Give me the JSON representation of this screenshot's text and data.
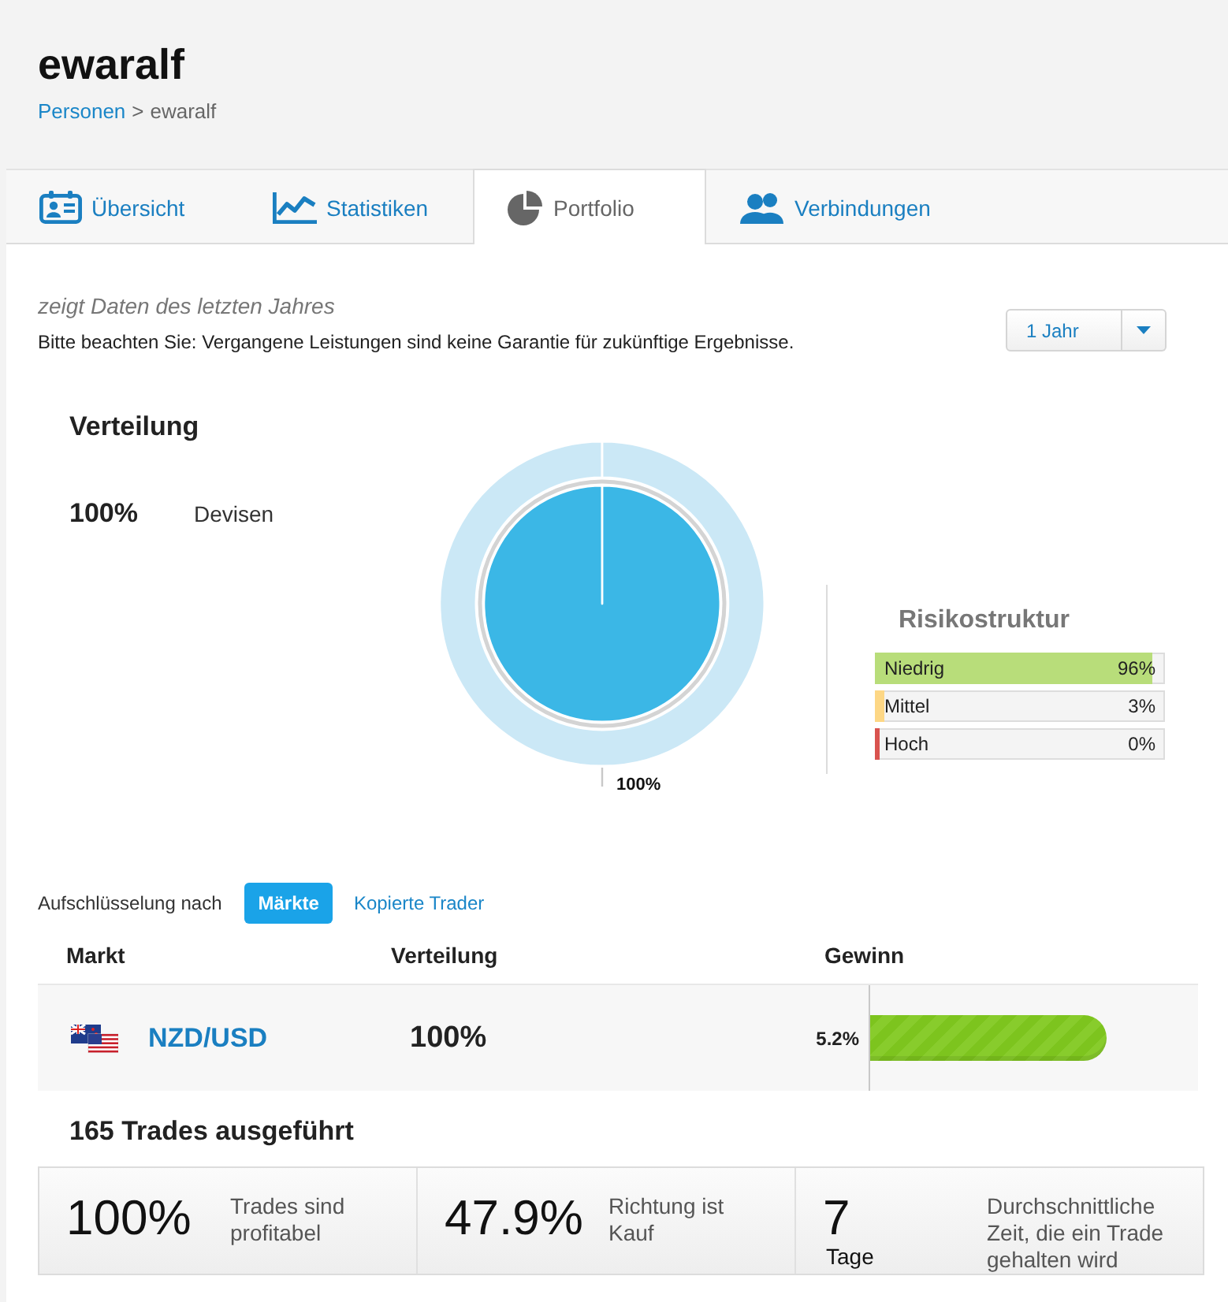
{
  "profile": {
    "name": "ewaralf",
    "breadcrumb": {
      "parent": "Personen",
      "separator": ">",
      "current": "ewaralf"
    }
  },
  "tabs": [
    {
      "label": "Übersicht",
      "kind": "overview",
      "selected": false
    },
    {
      "label": "Statistiken",
      "kind": "statistics",
      "selected": false
    },
    {
      "label": "Portfolio",
      "kind": "portfolio",
      "selected": true
    },
    {
      "label": "Verbindungen",
      "kind": "connections",
      "selected": false
    }
  ],
  "period": {
    "notice": "zeigt Daten des letzten Jahres",
    "disclaimer": "Bitte beachten Sie: Vergangene Leistungen sind keine Garantie für zukünftige Ergebnisse.",
    "dropdown": {
      "value": "1 Jahr"
    }
  },
  "distribution": {
    "title": "Verteilung",
    "legend": [
      {
        "share": "100%"
      }
    ],
    "chart_data": {
      "type": "pie",
      "categories": [
        "Devisen"
      ],
      "values": [
        100
      ],
      "value_labels": [
        "100%"
      ]
    }
  },
  "risk": {
    "title": "Risikostruktur",
    "items": [
      {
        "label": "Niedrig",
        "value": "96%",
        "level": 0.96,
        "color": "#b8dd7a"
      },
      {
        "label": "Mittel",
        "value": "3%",
        "level": 0.03,
        "color": "#fdd785"
      },
      {
        "label": "Hoch",
        "value": "0%",
        "level": 0,
        "color": "#d9534f"
      }
    ]
  },
  "breakdown": {
    "label": "Aufschlüsselung nach",
    "options": [
      {
        "label": "Märkte",
        "selected": true
      },
      {
        "label": "Kopierte Trader",
        "selected": false
      }
    ]
  },
  "markets": {
    "columns": [
      "Markt",
      "Verteilung",
      "Gewinn"
    ],
    "rows": [
      {
        "market": "NZD/USD",
        "share": "100%",
        "profit": "5.2%",
        "level": 0.72
      }
    ]
  },
  "trades": {
    "title": "165 Trades ausgeführt",
    "stats": [
      {
        "value": "100%",
        "caption": "Trades sind profitabel"
      },
      {
        "value": "47.9%",
        "caption": "Richtung ist Kauf"
      },
      {
        "value": "7",
        "unit": "Tage",
        "caption": "Durchschnittliche Zeit, die ein Trade gehalten wird"
      }
    ]
  }
}
